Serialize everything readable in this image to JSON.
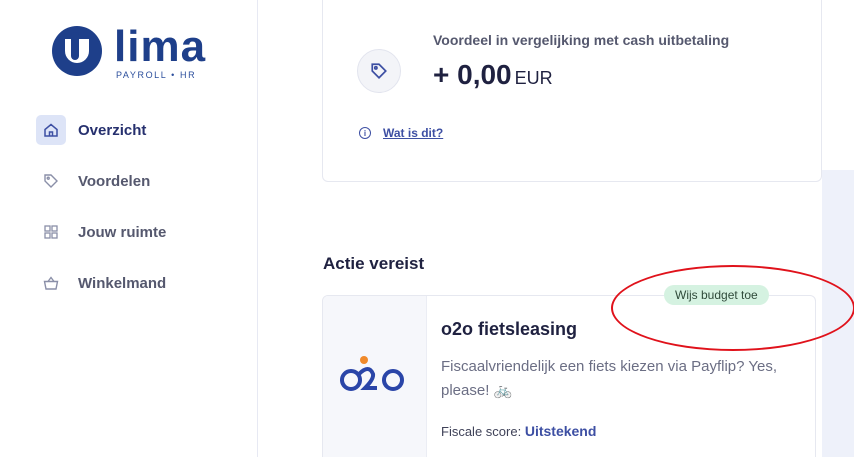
{
  "brand": {
    "name": "lima",
    "tagline": "PAYROLL • HR"
  },
  "sidebar": {
    "items": [
      {
        "label": "Overzicht",
        "icon": "home-icon",
        "active": true
      },
      {
        "label": "Voordelen",
        "icon": "tag-icon",
        "active": false
      },
      {
        "label": "Jouw ruimte",
        "icon": "grid-icon",
        "active": false
      },
      {
        "label": "Winkelmand",
        "icon": "basket-icon",
        "active": false
      }
    ]
  },
  "savings": {
    "label": "Voordeel in vergelijking met cash uitbetaling",
    "value": "+ 0,00",
    "unit": "EUR",
    "info_link": "Wat is dit?"
  },
  "actions": {
    "title": "Actie vereist",
    "offer": {
      "title": "o2o fietsleasing",
      "description": "Fiscaalvriendelijk een fiets kiezen via Payflip? Yes, please! 🚲",
      "score_label": "Fiscale score:",
      "score_value": "Uitstekend",
      "badge": "Wijs budget toe",
      "logo_text": "o2o"
    }
  },
  "colors": {
    "accent": "#3d4fa3",
    "brand": "#1e3f8a",
    "badge_bg": "#d5f2e1",
    "annotation": "#e0121b"
  }
}
